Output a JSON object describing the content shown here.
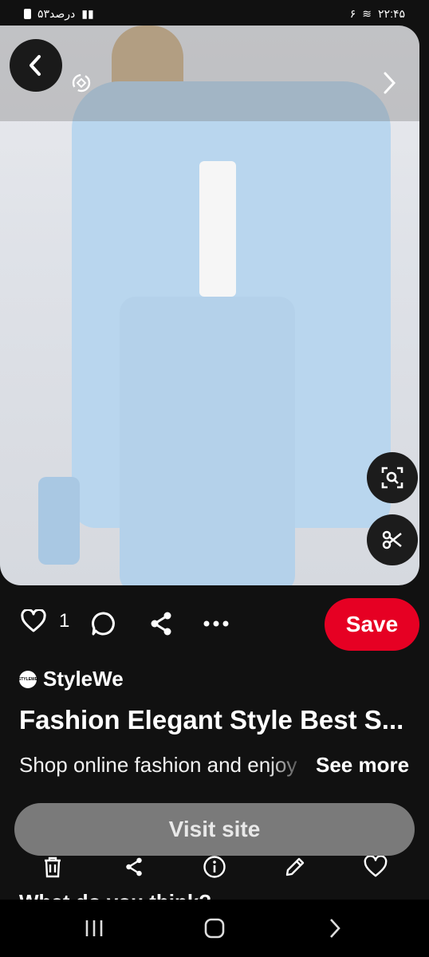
{
  "status_bar": {
    "left_text": "۵۳درصد",
    "right_text": "۲۲:۴۵",
    "network": "۶"
  },
  "pin": {
    "likes": "1",
    "save_label": "Save",
    "brand": "StyleWe",
    "brand_logo_text": "STYLEWE",
    "title": "Fashion Elegant Style Best S...",
    "description": "Shop online fashion and enjoy",
    "see_more": "See more",
    "visit_label": "Visit site",
    "next_section_heading": "What do you think?"
  },
  "colors": {
    "save": "#e60023",
    "background": "#111111"
  },
  "icons": {
    "back": "chevron-left-icon",
    "rotate": "rotate-icon",
    "next": "chevron-right-icon",
    "lens": "visual-search-icon",
    "scissors": "scissors-icon",
    "heart": "heart-icon",
    "comment": "comment-icon",
    "share": "share-icon",
    "more": "more-icon",
    "trash": "trash-icon",
    "info": "info-icon",
    "edit": "pencil-icon",
    "like": "heart-icon"
  }
}
